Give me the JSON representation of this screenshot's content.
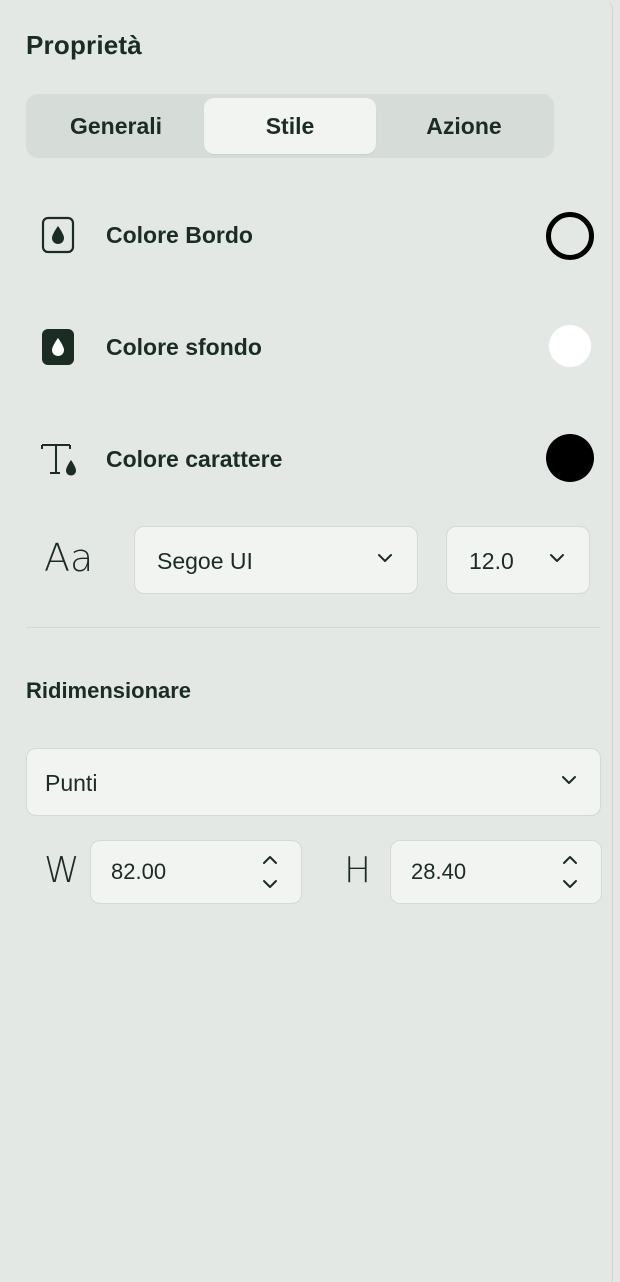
{
  "panel": {
    "title": "Proprietà"
  },
  "tabs": [
    {
      "label": "Generali",
      "selected": false
    },
    {
      "label": "Stile",
      "selected": true
    },
    {
      "label": "Azione",
      "selected": false
    }
  ],
  "style": {
    "border_color": {
      "label": "Colore Bordo",
      "icon": "droplet-outline-icon",
      "value": "#000000",
      "fill": "transparent"
    },
    "background_color": {
      "label": "Colore sfondo",
      "icon": "droplet-filled-icon",
      "value": "#ffffff"
    },
    "font_color": {
      "label": "Colore carattere",
      "icon": "text-color-icon",
      "value": "#000000"
    },
    "font": {
      "icon_text": "Aa",
      "family": "Segoe UI",
      "size": "12.0"
    }
  },
  "resize": {
    "section_title": "Ridimensionare",
    "unit": "Punti",
    "width_label": "W",
    "width_value": "82.00",
    "height_label": "H",
    "height_value": "28.40"
  }
}
